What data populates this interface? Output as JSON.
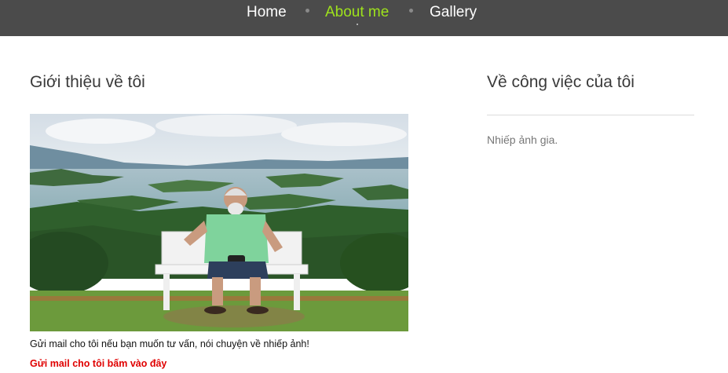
{
  "nav": {
    "items": [
      {
        "label": "Home",
        "active": false
      },
      {
        "label": "About me",
        "active": true
      },
      {
        "label": "Gallery",
        "active": false
      }
    ],
    "active_color": "#9ee21c",
    "bar_color": "#4b4b4b"
  },
  "left": {
    "title": "Giới thiệu về tôi",
    "caption": "Gửi mail cho tôi nếu bạn muốn tư vấn, nói chuyện về nhiếp ảnh!",
    "mail_link": "Gửi mail cho tôi bấm vào đây",
    "link_color": "#e00000"
  },
  "right": {
    "title": "Về công việc của tôi",
    "text": "Nhiếp ảnh gia."
  }
}
